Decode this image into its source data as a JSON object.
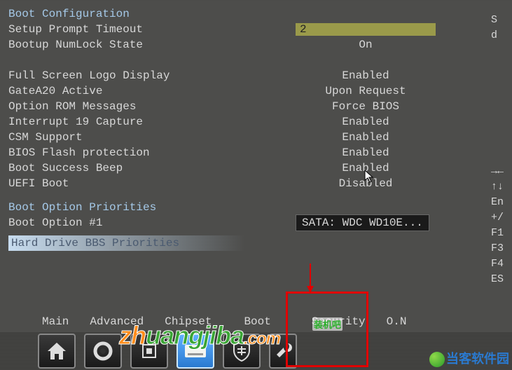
{
  "sections": {
    "boot_config_header": "Boot Configuration",
    "boot_priorities_header": "Boot Option Priorities"
  },
  "settings": [
    {
      "label": "Setup Prompt Timeout",
      "value": "2",
      "selected": true
    },
    {
      "label": "Bootup NumLock State",
      "value": "On"
    },
    {
      "label": "",
      "value": ""
    },
    {
      "label": "Full Screen Logo Display",
      "value": "Enabled"
    },
    {
      "label": "GateA20 Active",
      "value": "Upon Request"
    },
    {
      "label": "Option ROM Messages",
      "value": "Force BIOS"
    },
    {
      "label": "Interrupt 19 Capture",
      "value": "Enabled"
    },
    {
      "label": "CSM Support",
      "value": "Enabled"
    },
    {
      "label": "BIOS Flash protection",
      "value": "Enabled"
    },
    {
      "label": "Boot Success Beep",
      "value": "Enabled"
    },
    {
      "label": "UEFI Boot",
      "value": "Disabled"
    }
  ],
  "boot_option": {
    "label": "Boot Option #1",
    "value": "SATA: WDC WD10E..."
  },
  "highlighted_row": "Hard Drive BBS Priorities",
  "tabs": [
    "Main",
    "Advanced",
    "Chipset",
    "Boot",
    "Security",
    "O.N"
  ],
  "active_tab_index": 3,
  "right_hints": [
    "S",
    "d",
    "",
    "",
    "",
    "",
    "",
    "",
    "",
    "",
    "",
    "→←",
    "↑↓",
    "En",
    "+/",
    "F1",
    "F3",
    "F4",
    "ES"
  ],
  "icons": [
    "home",
    "gear",
    "chip",
    "disk",
    "shield",
    "wrench"
  ],
  "watermark_main": {
    "z": "zh",
    "rest": "uangjiba",
    "com": ".com"
  },
  "watermark_small": "装机吧",
  "watermark_corner": "当客软件园"
}
